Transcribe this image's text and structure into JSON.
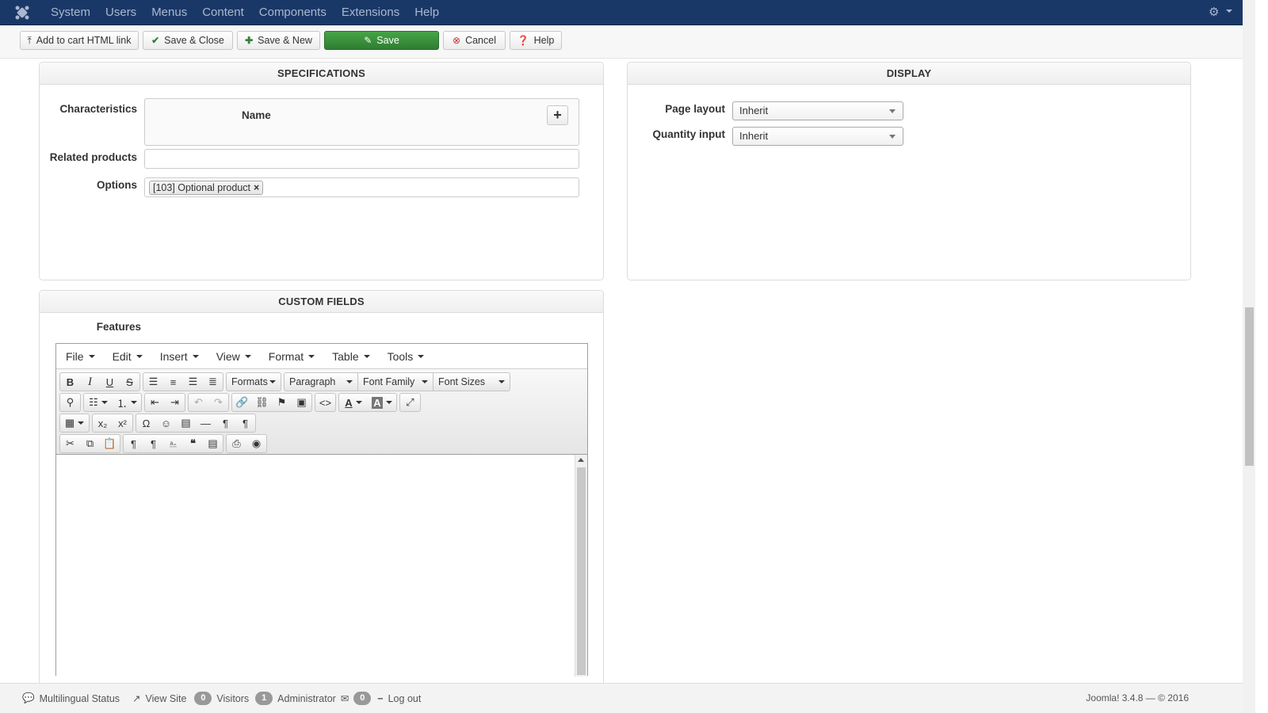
{
  "nav": {
    "items": [
      "System",
      "Users",
      "Menus",
      "Content",
      "Components",
      "Extensions",
      "Help"
    ]
  },
  "toolbar": {
    "add_to_cart": "Add to cart HTML link",
    "save_close": "Save & Close",
    "save_new": "Save & New",
    "save": "Save",
    "cancel": "Cancel",
    "help": "Help"
  },
  "specifications": {
    "title": "SPECIFICATIONS",
    "characteristics_label": "Characteristics",
    "characteristics_column": "Name",
    "related_label": "Related products",
    "options_label": "Options",
    "options_tag": "[103] Optional product"
  },
  "display": {
    "title": "DISPLAY",
    "page_layout_label": "Page layout",
    "page_layout_value": "Inherit",
    "quantity_label": "Quantity input",
    "quantity_value": "Inherit"
  },
  "custom_fields": {
    "title": "CUSTOM FIELDS",
    "features_label": "Features"
  },
  "editor": {
    "menus": [
      "File",
      "Edit",
      "Insert",
      "View",
      "Format",
      "Table",
      "Tools"
    ],
    "formats": "Formats",
    "paragraph": "Paragraph",
    "font_family": "Font Family",
    "font_sizes": "Font Sizes"
  },
  "footer": {
    "multilingual": "Multilingual Status",
    "view_site": "View Site",
    "visitors_count": "0",
    "visitors": "Visitors",
    "admin_count": "1",
    "administrator": "Administrator",
    "messages_count": "0",
    "logout": "Log out",
    "version": "Joomla! 3.4.8 — © 2016"
  },
  "colors": {
    "navbar": "#1a3867",
    "save_button": "#46a546",
    "cancel_icon": "#bd362f"
  }
}
